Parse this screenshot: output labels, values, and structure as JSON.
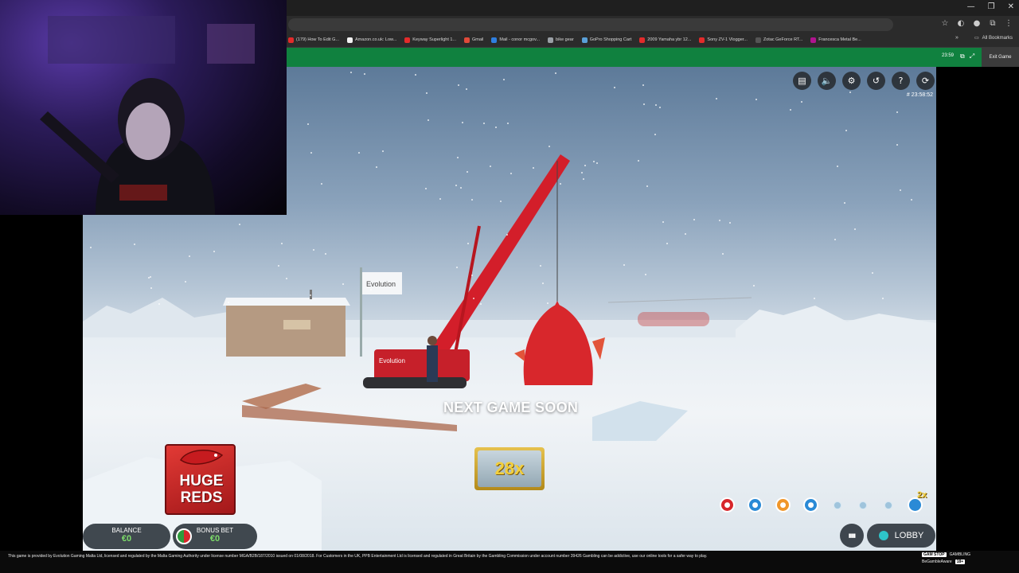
{
  "browser": {
    "window_controls": [
      "—",
      "❐",
      "✕"
    ],
    "address_icons": [
      "☆",
      "◐",
      "●",
      "⧉",
      "⋮"
    ],
    "bookmarks": [
      {
        "label": "(179) How To Edit G...",
        "color": "#e32b2b"
      },
      {
        "label": "Amazon.co.uk: Low...",
        "color": "#f3f3f3"
      },
      {
        "label": "Keyway Superlight 1...",
        "color": "#e32b2b"
      },
      {
        "label": "Gmail",
        "color": "#e04a3a"
      },
      {
        "label": "Mail - conor mcgov...",
        "color": "#2f7fe0"
      },
      {
        "label": "bike gear",
        "color": "#9aa0a6"
      },
      {
        "label": "GoPro Shopping Cart",
        "color": "#5aa0d8"
      },
      {
        "label": "2009 Yamaha ybr 12...",
        "color": "#e32b2b"
      },
      {
        "label": "Sony ZV-1 Vlogger...",
        "color": "#e32b2b"
      },
      {
        "label": "Zotac GeForce RT...",
        "color": "#555"
      },
      {
        "label": "Francesca Metal Be...",
        "color": "#b0138f"
      }
    ],
    "chevron": "»",
    "all_bookmarks": "All Bookmarks"
  },
  "site": {
    "time": "23:59",
    "exit_label": "Exit Game"
  },
  "game": {
    "controls": [
      {
        "name": "chat-icon",
        "glyph": "▤"
      },
      {
        "name": "volume-icon",
        "glyph": "🔈"
      },
      {
        "name": "settings-icon",
        "glyph": "⚙"
      },
      {
        "name": "history-icon",
        "glyph": "↺"
      },
      {
        "name": "help-icon",
        "glyph": "?"
      },
      {
        "name": "fullscreen-icon",
        "glyph": "⟳"
      }
    ],
    "game_id": "# 23:58:52",
    "status": "NEXT GAME SOON",
    "multiplier": "28x",
    "logo_text": "HUGE REDS",
    "history_multiplier": "2x",
    "history": [
      {
        "color": "#d7262b",
        "glyph": "●"
      },
      {
        "color": "#2a8ad6",
        "glyph": "●"
      },
      {
        "color": "#f0962a",
        "glyph": "●"
      },
      {
        "color": "#2a8ad6",
        "glyph": "●"
      }
    ],
    "balance": {
      "label": "BALANCE",
      "value": "€0"
    },
    "bonus_bet": {
      "label": "BONUS BET",
      "value": "€0"
    },
    "lobby_label": "LOBBY",
    "stats_glyph": "▮▮▮"
  },
  "footer": {
    "text": "This game is provided by Evolution Gaming Malta Ltd, licensed and regulated by the Malta Gaming Authority under license number MGA/B2B/187/2010 issued on 01/08/2018. For Customers in the UK, PPB Entertainment Ltd is licensed and regulated in Great Britain by the Gambling Commission under account number 39426 Gambling can be addictive, use our online tools for a safer way to play.",
    "logo1": "GAM STOP",
    "logo2": "GAMBLING",
    "logo3": "BeGambleAware",
    "age": "18+"
  }
}
